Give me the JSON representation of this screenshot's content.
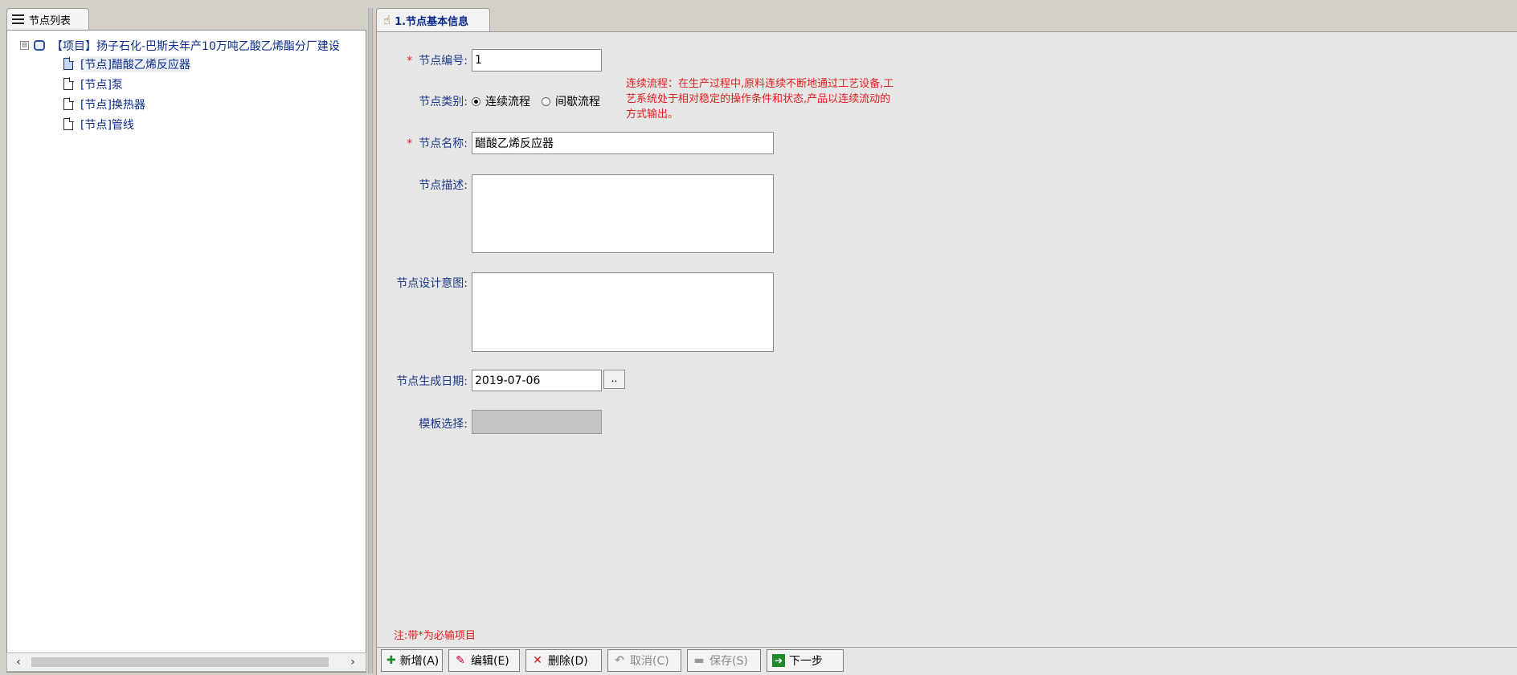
{
  "left": {
    "tab_title": "节点列表",
    "tree": {
      "project_label": "【项目】扬子石化-巴斯夫年产10万吨乙酸乙烯酯分厂建设",
      "expander": "⊟",
      "nodes": [
        "[节点]醋酸乙烯反应器",
        "[节点]泵",
        "[节点]换热器",
        "[节点]管线"
      ],
      "selected_index": 0
    },
    "scroll": {
      "left_arrow": "‹",
      "right_arrow": "›"
    }
  },
  "right": {
    "tab_title": "1.节点基本信息",
    "form": {
      "required_mark": "*",
      "node_number_label": "节点编号:",
      "node_number_value": "1",
      "node_type_label": "节点类别:",
      "type_options": [
        "连续流程",
        "间歇流程"
      ],
      "type_selected": "连续流程",
      "type_hint": "连续流程：在生产过程中,原料连续不断地通过工艺设备,工艺系统处于相对稳定的操作条件和状态,产品以连续流动的方式输出。",
      "node_name_label": "节点名称:",
      "node_name_value": "醋酸乙烯反应器",
      "node_desc_label": "节点描述:",
      "node_desc_value": "",
      "design_intent_label": "节点设计意图:",
      "design_intent_value": "",
      "date_label": "节点生成日期:",
      "date_value": "2019-07-06",
      "date_button": "..",
      "template_label": "模板选择:"
    },
    "note": "注:带*为必输项目",
    "toolbar": {
      "add": "新增(A)",
      "edit": "编辑(E)",
      "delete": "删除(D)",
      "cancel": "取消(C)",
      "save": "保存(S)",
      "next": "下一步"
    }
  },
  "colors": {
    "label_blue": "#1e3a8a",
    "required_red": "#e02020",
    "tree_text": "#0a2b8c"
  }
}
